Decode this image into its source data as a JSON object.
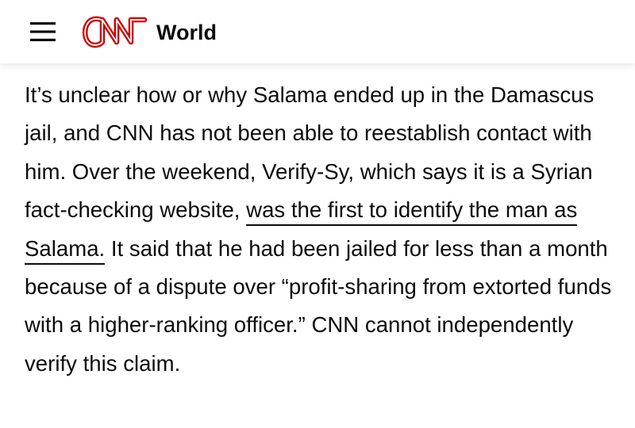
{
  "header": {
    "logo_text": "CNN",
    "section": "World",
    "menu_icon": "hamburger-menu-icon",
    "brand_color": "#CC0000"
  },
  "article": {
    "paragraph": {
      "before_link": "It’s unclear how or why Salama ended up in the Damascus jail, and CNN has not been able to reestablish contact with him. Over the weekend, Verify-Sy, which says it is a Syrian fact-checking website, ",
      "link_text": "was the first to identify the man as Salama.",
      "after_link": " It said that he had been jailed for less than a month because of a dispute over “profit-sharing from extorted funds with a higher-ranking officer.” CNN cannot independently verify this claim."
    }
  }
}
